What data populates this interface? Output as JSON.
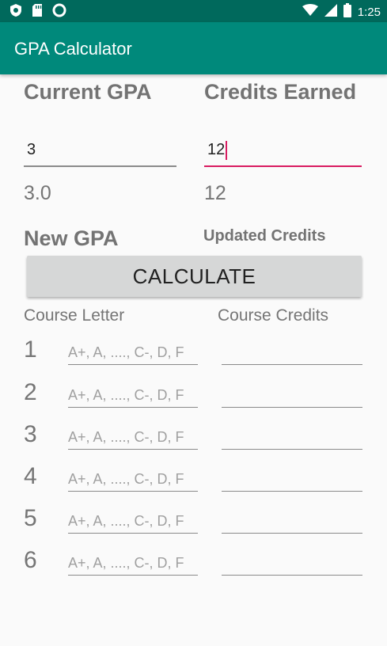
{
  "statusbar": {
    "time": "1:25"
  },
  "appbar": {
    "title": "GPA Calculator"
  },
  "current_gpa": {
    "label": "Current GPA",
    "input_value": "3",
    "display": "3.0"
  },
  "credits_earned": {
    "label": "Credits Earned",
    "input_value": "12",
    "display": "12"
  },
  "new_gpa": {
    "label": "New GPA"
  },
  "updated_credits": {
    "label": "Updated Credits"
  },
  "calculate_label": "CALCULATE",
  "courses": {
    "letter_header": "Course Letter",
    "credits_header": "Course Credits",
    "letter_hint": "A+, A, ...., C-, D, F",
    "rows": [
      {
        "num": "1"
      },
      {
        "num": "2"
      },
      {
        "num": "3"
      },
      {
        "num": "4"
      },
      {
        "num": "5"
      },
      {
        "num": "6"
      }
    ]
  }
}
